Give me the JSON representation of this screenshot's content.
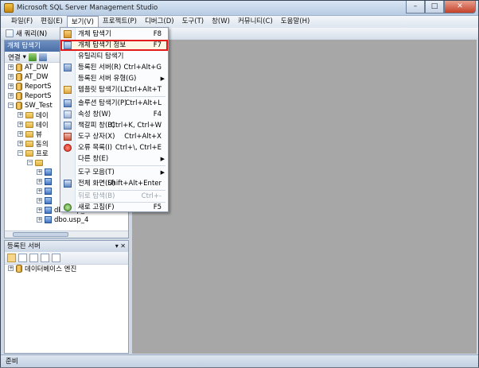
{
  "window": {
    "title": "Microsoft SQL Server Management Studio"
  },
  "menubar": [
    "파일(F)",
    "편집(E)",
    "보기(V)",
    "프로젝트(P)",
    "디버그(D)",
    "도구(T)",
    "창(W)",
    "커뮤니티(C)",
    "도움말(H)"
  ],
  "toolbar": {
    "new_query": "새 쿼리(N)"
  },
  "object_explorer": {
    "header": "개체 탐색기",
    "connect": "연결",
    "nodes": [
      {
        "label": "AT_DW"
      },
      {
        "label": "AT_DW"
      },
      {
        "label": "ReportS"
      },
      {
        "label": "ReportS"
      },
      {
        "label": "SW_Test"
      },
      {
        "label": "데이"
      },
      {
        "label": "테이"
      },
      {
        "label": "뷰"
      },
      {
        "label": "동의"
      },
      {
        "label": "프로"
      },
      {
        "label": "dbo.usp_3"
      },
      {
        "label": "dbo.usp_4"
      }
    ]
  },
  "registered_servers": {
    "header": "등록된 서버",
    "pin": "▾ ✕",
    "item": "데이터베이스 엔진"
  },
  "view_menu": {
    "items": [
      {
        "label": "개체 탐색기",
        "key": "F8"
      },
      {
        "label": "개체 탐색기 정보",
        "key": "F7",
        "highlighted": true
      },
      {
        "label": "유틸리티 탐색기",
        "key": ""
      },
      {
        "label": "등록된 서버(R)",
        "key": "Ctrl+Alt+G"
      },
      {
        "label": "등록된 서버 유형(G)",
        "key": "",
        "submenu": true
      },
      {
        "label": "템플릿 탐색기(L)",
        "key": "Ctrl+Alt+T"
      },
      {
        "label": "솔루션 탐색기(P)",
        "key": "Ctrl+Alt+L"
      },
      {
        "label": "속성 창(W)",
        "key": "F4"
      },
      {
        "label": "책갈피 창(B)",
        "key": "Ctrl+K, Ctrl+W"
      },
      {
        "label": "도구 상자(X)",
        "key": "Ctrl+Alt+X"
      },
      {
        "label": "오류 목록(I)",
        "key": "Ctrl+\\, Ctrl+E"
      },
      {
        "label": "다른 창(E)",
        "key": "",
        "submenu": true
      },
      {
        "label": "도구 모음(T)",
        "key": "",
        "submenu": true
      },
      {
        "label": "전체 화면(U)",
        "key": "Shift+Alt+Enter"
      },
      {
        "label": "뒤로 탐색(B)",
        "key": "Ctrl+-",
        "disabled": true
      },
      {
        "label": "새로 고침(F)",
        "key": "F5"
      }
    ]
  },
  "statusbar": {
    "text": "준비"
  }
}
